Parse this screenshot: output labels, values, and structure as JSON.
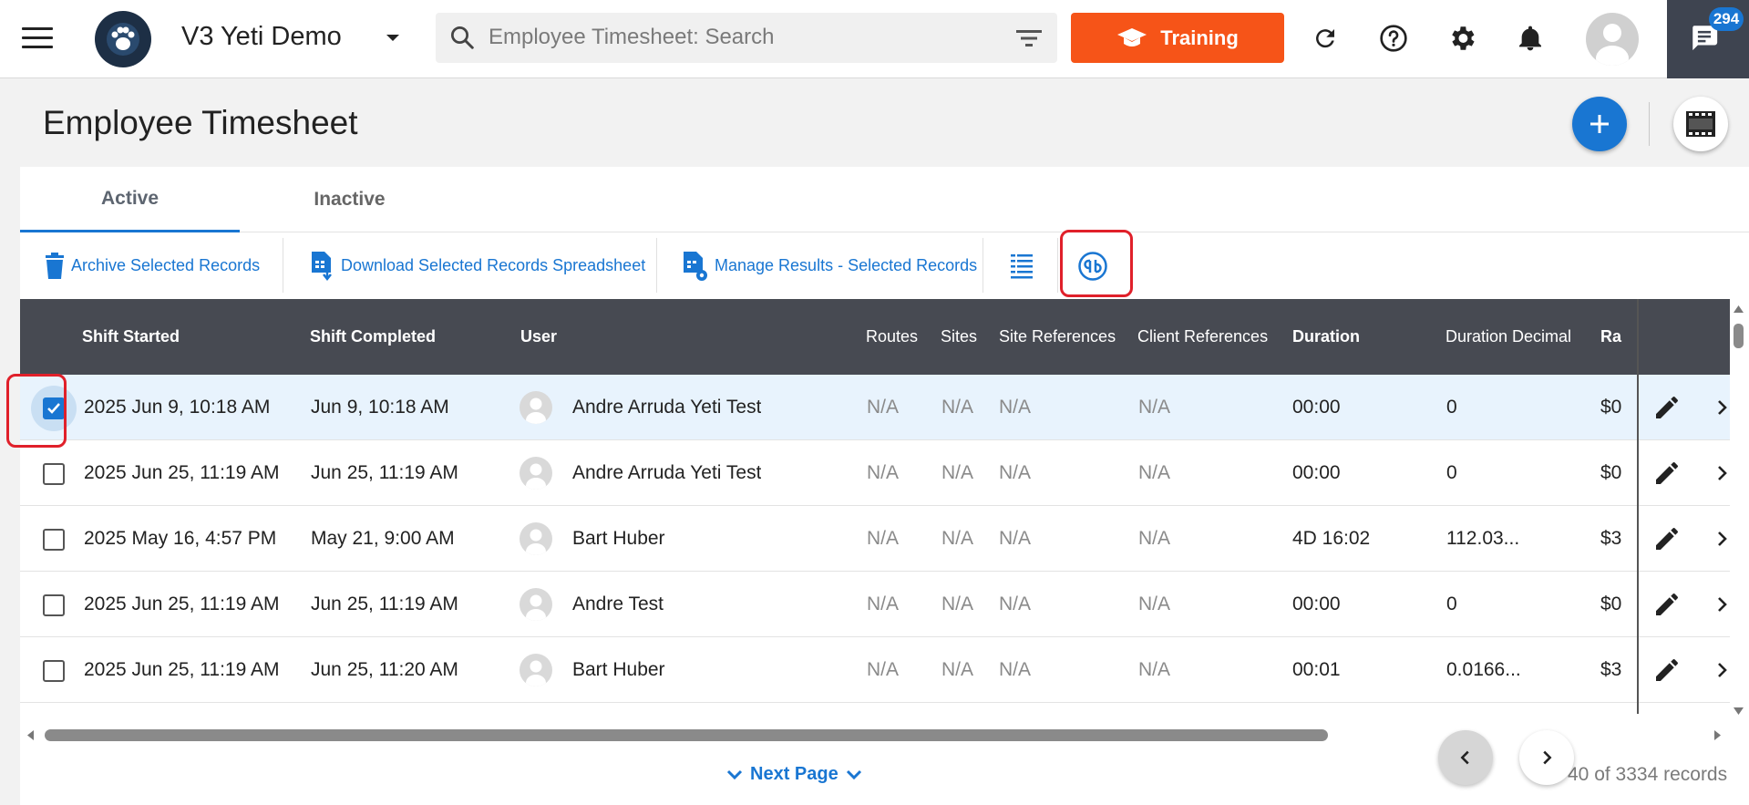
{
  "app": {
    "org_name": "V3 Yeti Demo",
    "search_placeholder": "Employee Timesheet: Search",
    "training_label": "Training",
    "chat_badge_count": "294",
    "accent_color": "#1976d2",
    "training_color": "#f65418"
  },
  "page": {
    "title": "Employee Timesheet"
  },
  "tabs": [
    {
      "label": "Active",
      "active": true
    },
    {
      "label": "Inactive",
      "active": false
    }
  ],
  "toolbar": {
    "archive_label": "Archive Selected Records",
    "download_label": "Download Selected Records Spreadsheet",
    "manage_label": "Manage Results - Selected Records",
    "columns_icon": "column-settings-icon",
    "quickbooks_icon": "quickbooks-icon"
  },
  "table": {
    "columns": [
      "Shift Started",
      "Shift Completed",
      "User",
      "Routes",
      "Sites",
      "Site References",
      "Client References",
      "Duration",
      "Duration Decimal",
      "Ra"
    ],
    "rows": [
      {
        "selected": true,
        "shift_started": "2025 Jun 9, 10:18 AM",
        "shift_completed": "Jun 9, 10:18 AM",
        "user": "Andre Arruda Yeti Test",
        "routes": "N/A",
        "sites": "N/A",
        "site_refs": "N/A",
        "client_refs": "N/A",
        "duration": "00:00",
        "duration_decimal": "0",
        "rate": "$0"
      },
      {
        "selected": false,
        "shift_started": "2025 Jun 25, 11:19 AM",
        "shift_completed": "Jun 25, 11:19 AM",
        "user": "Andre Arruda Yeti Test",
        "routes": "N/A",
        "sites": "N/A",
        "site_refs": "N/A",
        "client_refs": "N/A",
        "duration": "00:00",
        "duration_decimal": "0",
        "rate": "$0"
      },
      {
        "selected": false,
        "shift_started": "2025 May 16, 4:57 PM",
        "shift_completed": "May 21, 9:00 AM",
        "user": "Bart Huber",
        "routes": "N/A",
        "sites": "N/A",
        "site_refs": "N/A",
        "client_refs": "N/A",
        "duration": "4D 16:02",
        "duration_decimal": "112.03...",
        "rate": "$3"
      },
      {
        "selected": false,
        "shift_started": "2025 Jun 25, 11:19 AM",
        "shift_completed": "Jun 25, 11:19 AM",
        "user": "Andre Test",
        "routes": "N/A",
        "sites": "N/A",
        "site_refs": "N/A",
        "client_refs": "N/A",
        "duration": "00:00",
        "duration_decimal": "0",
        "rate": "$0"
      },
      {
        "selected": false,
        "shift_started": "2025 Jun 25, 11:19 AM",
        "shift_completed": "Jun 25, 11:20 AM",
        "user": "Bart Huber",
        "routes": "N/A",
        "sites": "N/A",
        "site_refs": "N/A",
        "client_refs": "N/A",
        "duration": "00:01",
        "duration_decimal": "0.0166...",
        "rate": "$3"
      }
    ]
  },
  "footer": {
    "next_page_label": "Next Page",
    "records_text": "40 of 3334 records"
  }
}
